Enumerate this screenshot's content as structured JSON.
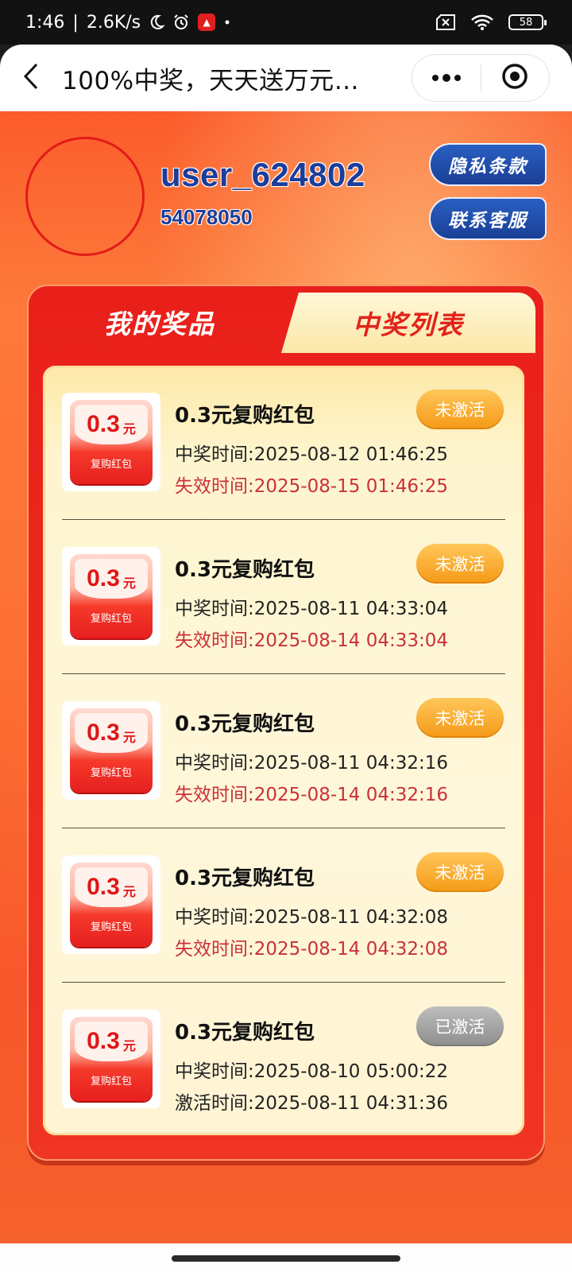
{
  "status_bar": {
    "time": "1:46",
    "network_speed": "2.6K/s",
    "battery": "58",
    "icons": [
      "moon-icon",
      "alarm-icon",
      "app-badge-icon",
      "dot-icon",
      "sim-off-icon",
      "wifi-icon",
      "battery-icon"
    ]
  },
  "nav": {
    "title": "100%中奖，天天送万元…"
  },
  "profile": {
    "username": "user_624802",
    "user_id": "54078050"
  },
  "buttons": {
    "privacy": "隐私条款",
    "service": "联系客服"
  },
  "tabs": {
    "my_prizes": "我的奖品",
    "winners_list": "中奖列表"
  },
  "prizes": [
    {
      "amount": "0.3",
      "unit": "元",
      "thumb_label": "复购红包",
      "title": "0.3元复购红包",
      "line1": "中奖时间:2025-08-12 01:46:25",
      "line2": "失效时间:2025-08-15 01:46:25",
      "status": "未激活"
    },
    {
      "amount": "0.3",
      "unit": "元",
      "thumb_label": "复购红包",
      "title": "0.3元复购红包",
      "line1": "中奖时间:2025-08-11 04:33:04",
      "line2": "失效时间:2025-08-14 04:33:04",
      "status": "未激活"
    },
    {
      "amount": "0.3",
      "unit": "元",
      "thumb_label": "复购红包",
      "title": "0.3元复购红包",
      "line1": "中奖时间:2025-08-11 04:32:16",
      "line2": "失效时间:2025-08-14 04:32:16",
      "status": "未激活"
    },
    {
      "amount": "0.3",
      "unit": "元",
      "thumb_label": "复购红包",
      "title": "0.3元复购红包",
      "line1": "中奖时间:2025-08-11 04:32:08",
      "line2": "失效时间:2025-08-14 04:32:08",
      "status": "未激活"
    },
    {
      "amount": "0.3",
      "unit": "元",
      "thumb_label": "复购红包",
      "title": "0.3元复购红包",
      "line1": "中奖时间:2025-08-10 05:00:22",
      "line2": "激活时间:2025-08-11 04:31:36",
      "status": "已激活"
    }
  ],
  "colors": {
    "accent_red": "#e9201a",
    "username_blue": "#1c3d9a",
    "button_blue": "#1a3f96",
    "status_inactive": "#f59a16",
    "status_active": "#8e8e8e",
    "expiry_text": "#c9313a"
  }
}
